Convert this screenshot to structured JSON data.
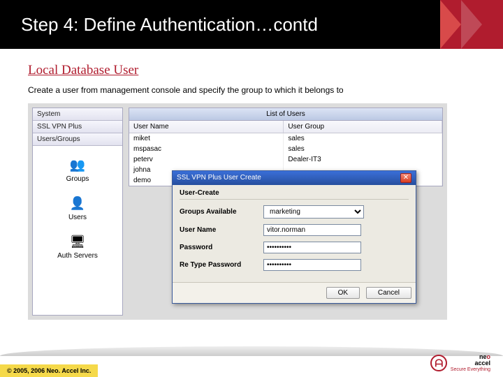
{
  "header": {
    "title": "Step 4: Define Authentication…contd"
  },
  "section": {
    "title": "Local Database User",
    "intro": "Create a user from management console and specify the group to which it belongs to"
  },
  "sidebar": {
    "tabs": {
      "0": "System",
      "1": "SSL VPN Plus",
      "2": "Users/Groups"
    },
    "items": {
      "groups": {
        "label": "Groups"
      },
      "users": {
        "label": "Users"
      },
      "authservers": {
        "label": "Auth Servers"
      }
    }
  },
  "panel": {
    "title": "List of Users",
    "columns": {
      "0": "User Name",
      "1": "User Group"
    },
    "rows": [
      {
        "user": "miket",
        "group": "sales"
      },
      {
        "user": "mspasac",
        "group": "sales"
      },
      {
        "user": "peterv",
        "group": "Dealer-IT3"
      },
      {
        "user": "johna",
        "group": ""
      },
      {
        "user": "demo",
        "group": ""
      }
    ]
  },
  "dialog": {
    "title": "SSL VPN Plus User Create",
    "legend": "User-Create",
    "labels": {
      "groups": "Groups Available",
      "username": "User Name",
      "password": "Password",
      "repassword": "Re Type Password"
    },
    "values": {
      "groups": "marketing",
      "username": "vitor.norman",
      "password": "••••••••••",
      "repassword": "••••••••••"
    },
    "buttons": {
      "ok": "OK",
      "cancel": "Cancel"
    }
  },
  "footer": {
    "copyright": "© 2005, 2006 Neo. Accel Inc.",
    "logo_name_a": "ne",
    "logo_name_b": "accel",
    "logo_o": "o",
    "logo_tag": "Secure Everything"
  }
}
